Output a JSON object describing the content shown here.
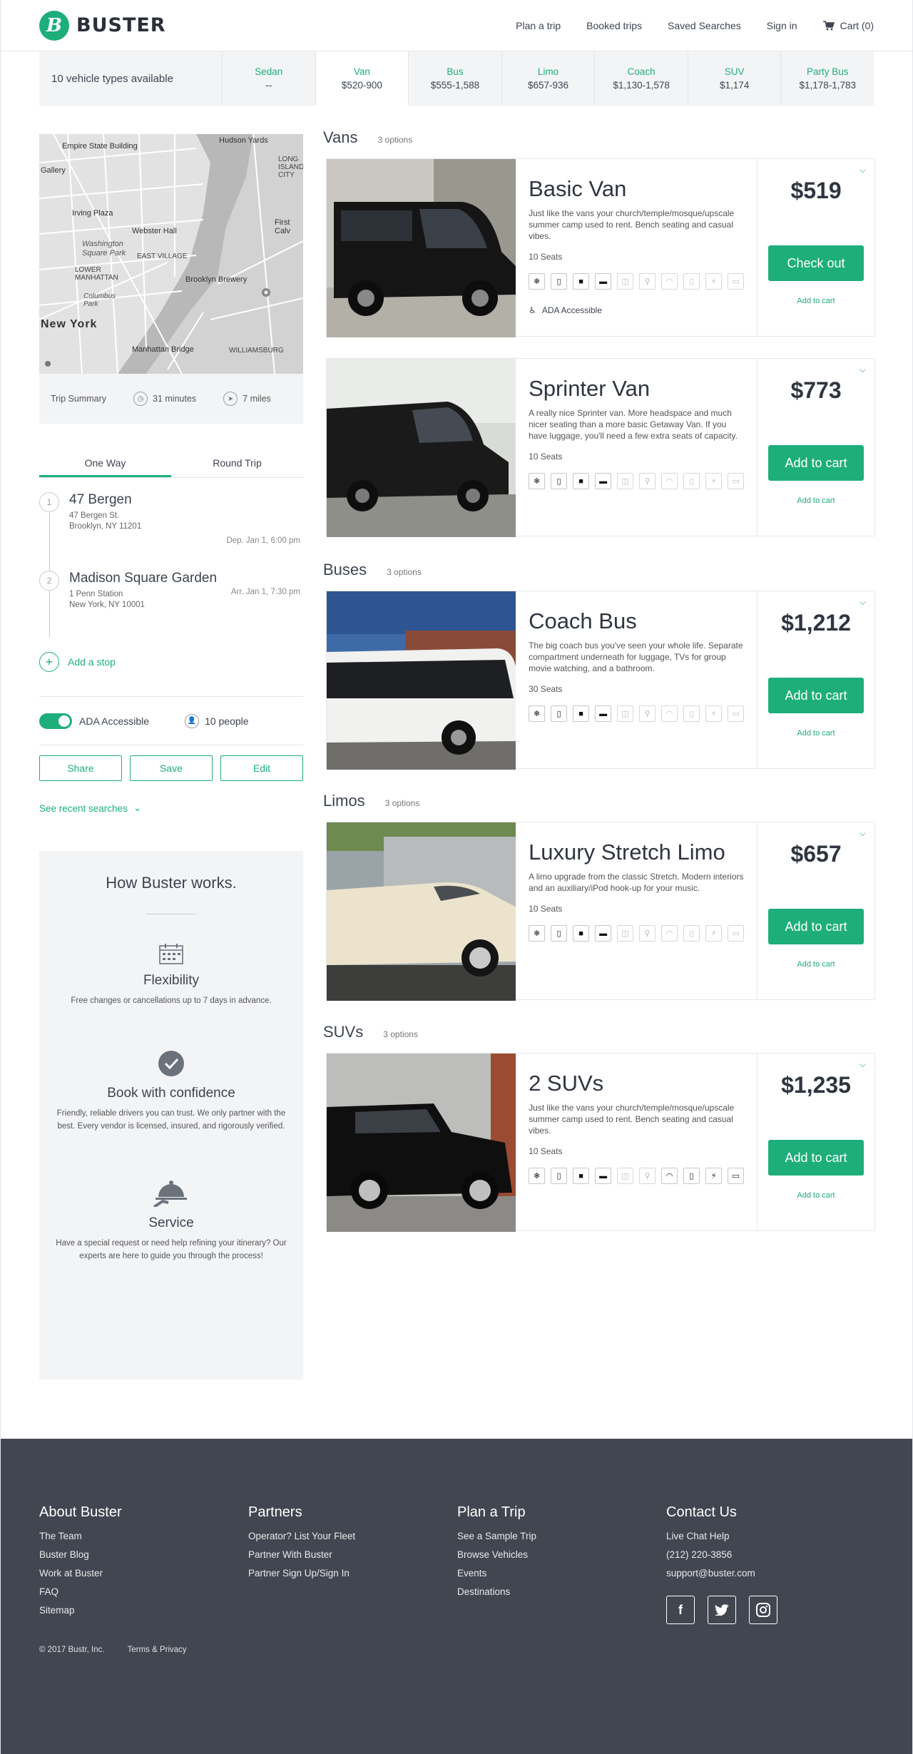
{
  "brand": {
    "name": "BUSTER",
    "logo_letter": "B",
    "accent": "#1eae7b"
  },
  "nav": {
    "items": [
      "Plan a trip",
      "Booked trips",
      "Saved Searches",
      "Sign in"
    ],
    "cart": "Cart (0)"
  },
  "typebar": {
    "count": "10 vehicle types available",
    "tabs": [
      {
        "name": "Sedan",
        "price": "--"
      },
      {
        "name": "Van",
        "price": "$520-900"
      },
      {
        "name": "Bus",
        "price": "$555-1,588"
      },
      {
        "name": "Limo",
        "price": "$657-936"
      },
      {
        "name": "Coach",
        "price": "$1,130-1,578"
      },
      {
        "name": "SUV",
        "price": "$1,174"
      },
      {
        "name": "Party Bus",
        "price": "$1,178-1,783"
      }
    ],
    "active_tab": "Van"
  },
  "map": {
    "labels": [
      "Empire State Building",
      "Hudson Yards",
      "Gallery",
      "Irving Plaza",
      "Webster Hall",
      "Washington Square Park",
      "EAST VILLAGE",
      "LOWER MANHATTAN",
      "Brooklyn Brewery",
      "Columbus Park",
      "New York",
      "Manhattan Bridge",
      "WILLIAMSBURG",
      "LONG ISLAND CITY",
      "First Calv"
    ]
  },
  "summary": {
    "label": "Trip Summary",
    "duration": "31 minutes",
    "distance": "7 miles"
  },
  "trip_type": {
    "one_way": "One Way",
    "round_trip": "Round Trip",
    "selected": "One Way"
  },
  "stops": [
    {
      "num": "1",
      "name": "47 Bergen",
      "addr1": "47 Bergen St.",
      "addr2": "Brooklyn, NY 11201",
      "time": "Dep.  Jan 1, 6:00 pm"
    },
    {
      "num": "2",
      "name": "Madison Square Garden",
      "addr1": "1 Penn Station",
      "addr2": "New York, NY 10001",
      "time": "Arr.  Jan 1, 7:30 pm"
    }
  ],
  "add_stop": "Add a stop",
  "options": {
    "ada": "ADA Accessible",
    "ada_on": true,
    "people": "10 people"
  },
  "buttons": {
    "share": "Share",
    "save": "Save",
    "edit": "Edit"
  },
  "recent": "See recent searches",
  "how": {
    "title": "How Buster works.",
    "features": [
      {
        "title": "Flexibility",
        "text": "Free changes or cancellations up to 7 days in advance."
      },
      {
        "title": "Book with confidence",
        "text": "Friendly, reliable drivers you can trust. We only partner with the best. Every vendor is licensed, insured, and rigorously verified."
      },
      {
        "title": "Service",
        "text": "Have a special request or need help refining your itinerary? Our experts are here to guide you through the process!"
      }
    ]
  },
  "sections": [
    {
      "title": "Vans",
      "count": "3 options",
      "cards": [
        {
          "name": "Basic Van",
          "desc": "Just like the vans your church/temple/mosque/upscale summer camp used to rent. Bench seating and casual vibes.",
          "seats": "10 Seats",
          "price": "$519",
          "cta": "Check out",
          "link": "Add to cart",
          "ada": "ADA Accessible"
        },
        {
          "name": "Sprinter Van",
          "desc": "A really nice Sprinter van. More headspace and much nicer seating than a more basic Getaway Van. If you have luggage, you'll need a few extra seats of capacity.",
          "seats": "10 Seats",
          "price": "$773",
          "cta": "Add to cart",
          "link": "Add to cart"
        }
      ]
    },
    {
      "title": "Buses",
      "count": "3 options",
      "cards": [
        {
          "name": "Coach Bus",
          "desc": "The big coach bus you've seen your whole life. Separate compartment underneath for luggage, TVs for group movie watching, and a bathroom.",
          "seats": "30 Seats",
          "price": "$1,212",
          "cta": "Add to cart",
          "link": "Add to cart"
        }
      ]
    },
    {
      "title": "Limos",
      "count": "3 options",
      "cards": [
        {
          "name": "Luxury Stretch Limo",
          "desc": "A limo upgrade from the classic Stretch. Modern interiors and an auxiliary/iPod hook-up for your music.",
          "seats": "10 Seats",
          "price": "$657",
          "cta": "Add to cart",
          "link": "Add to cart"
        }
      ]
    },
    {
      "title": "SUVs",
      "count": "3 options",
      "cards": [
        {
          "name": "2 SUVs",
          "desc": "Just like the vans your church/temple/mosque/upscale summer camp used to rent. Bench seating and casual vibes.",
          "seats": "10 Seats",
          "price": "$1,235",
          "cta": "Add to cart",
          "link": "Add to cart"
        }
      ]
    }
  ],
  "footer": {
    "cols": [
      {
        "title": "About Buster",
        "links": [
          "The Team",
          "Buster Blog",
          "Work at Buster",
          "FAQ",
          "Sitemap"
        ]
      },
      {
        "title": "Partners",
        "links": [
          "Operator? List Your Fleet",
          "Partner With Buster",
          "Partner Sign Up/Sign In"
        ]
      },
      {
        "title": "Plan a Trip",
        "links": [
          "See a Sample Trip",
          "Browse Vehicles",
          "Events",
          "Destinations"
        ]
      },
      {
        "title": "Contact Us",
        "links": [
          "Live Chat Help",
          "(212) 220-3856",
          "support@buster.com"
        ]
      }
    ],
    "social": [
      "facebook-icon",
      "twitter-icon",
      "instagram-icon"
    ],
    "copyright": "© 2017 Bustr, Inc.",
    "terms": "Terms & Privacy"
  }
}
